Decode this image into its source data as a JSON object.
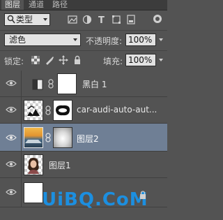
{
  "tabs": [
    {
      "label": "图层",
      "active": true
    },
    {
      "label": "通道",
      "active": false
    },
    {
      "label": "路径",
      "active": false
    }
  ],
  "filter": {
    "kind_label": "类型",
    "icons": [
      "image-filter-icon",
      "adjustment-filter-icon",
      "type-filter-icon",
      "shape-filter-icon",
      "smart-object-filter-icon"
    ]
  },
  "blend": {
    "mode": "滤色",
    "opacity_label": "不透明度:",
    "opacity_value": "100%"
  },
  "lock": {
    "label": "锁定:",
    "fill_label": "填充:",
    "fill_value": "100%"
  },
  "layers": [
    {
      "name": "黑白 1",
      "type": "adjustment",
      "selected": false
    },
    {
      "name": "car-audi-auto-aut...",
      "type": "masked",
      "selected": false
    },
    {
      "name": "图层2",
      "type": "masked",
      "selected": true
    },
    {
      "name": "图层1",
      "type": "image",
      "selected": false
    },
    {
      "name": "",
      "type": "background",
      "selected": false
    }
  ],
  "watermark": "UiBQ.CoM",
  "colors": {
    "panel_bg": "#535353",
    "selected_row": "#6f7f95",
    "watermark": "#1c8fe0"
  }
}
